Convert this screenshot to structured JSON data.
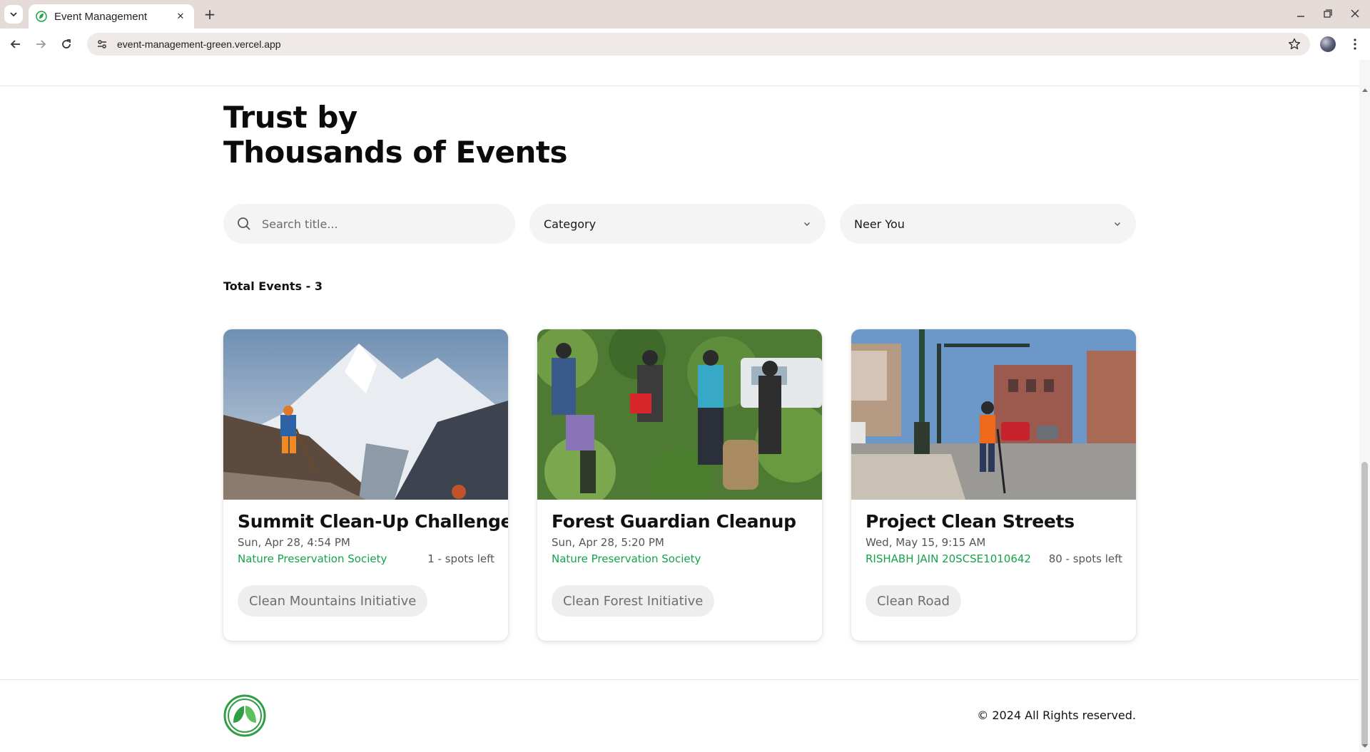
{
  "browser": {
    "tab_title": "Event Management",
    "url": "event-management-green.vercel.app",
    "new_tab_icon": "plus-icon"
  },
  "hero": {
    "line1": "Trust by",
    "line2": "Thousands of Events"
  },
  "filters": {
    "search_placeholder": "Search title...",
    "category_label": "Category",
    "location_label": "Neer You"
  },
  "summary": {
    "total_label": "Total Events - 3"
  },
  "events": [
    {
      "title": "Summit Clean-Up Challenge",
      "date": "Sun, Apr 28, 4:54 PM",
      "organizer": "Nature Preservation Society",
      "spots": "1 - spots left",
      "category": "Clean Mountains Initiative",
      "image": "mountain-cleanup-photo"
    },
    {
      "title": "Forest Guardian Cleanup",
      "date": "Sun, Apr 28, 5:20 PM",
      "organizer": "Nature Preservation Society",
      "spots": "",
      "category": "Clean Forest Initiative",
      "image": "forest-volunteers-photo"
    },
    {
      "title": "Project Clean Streets",
      "date": "Wed, May 15, 9:15 AM",
      "organizer": "RISHABH JAIN 20SCSE1010642",
      "spots": "80 - spots left",
      "category": "Clean Road",
      "image": "street-sweeper-photo"
    }
  ],
  "footer": {
    "copyright": "© 2024 All Rights reserved.",
    "logo": "leaf-logo-icon"
  },
  "colors": {
    "accent_green": "#16a34a",
    "chip_bg": "#eeeeee",
    "input_bg": "#f4f4f5"
  }
}
